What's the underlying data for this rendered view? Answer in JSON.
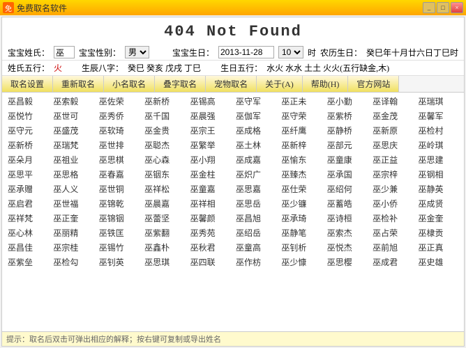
{
  "titleBar": {
    "icon": "免",
    "title": "免费取名软件",
    "controls": [
      "_",
      "□",
      "×"
    ]
  },
  "pageTitle": "404  Not  Found",
  "form": {
    "label_surname": "宝宝姓氏：",
    "surname_value": "巫",
    "label_gender": "宝宝性别：",
    "gender_options": [
      "男",
      "女"
    ],
    "gender_selected": "男",
    "label_birthday": "宝宝生日：",
    "birthday_value": "2013-11-28",
    "hour_value": "10",
    "hour_label": "时",
    "lunar_label": "农历生日：",
    "lunar_value": "癸巳年十月廿六日丁巳时",
    "label_wuxing": "姓氏五行：",
    "wuxing_value": "火",
    "label_bazi": "生辰八字：",
    "bazi_value": "癸巳 癸亥 戊戌 丁巳",
    "label_birthday_wuxing": "生日五行：",
    "birthday_wuxing": "水火 水水 土土 火火(五行缺金,木)"
  },
  "toolbar": {
    "buttons": [
      "取名设置",
      "重新取名",
      "小名取名",
      "叠字取名",
      "宠物取名",
      "关于(A)",
      "帮助(H)",
      "官方网站"
    ]
  },
  "names": [
    [
      "巫昌毅",
      "巫索毅",
      "巫佐荣",
      "巫新桥",
      "巫锡高",
      "巫守军",
      "巫正未",
      "巫小勤",
      "巫译翰",
      "巫瑞琪"
    ],
    [
      "巫悦竹",
      "巫世可",
      "巫秀侨",
      "巫千国",
      "巫晨强",
      "巫伽军",
      "巫守荣",
      "巫紫桥",
      "巫金茂",
      "巫馨军"
    ],
    [
      "巫守元",
      "巫盛茂",
      "巫软琦",
      "巫金贵",
      "巫宗王",
      "巫成格",
      "巫纤鹰",
      "巫静桥",
      "巫新原",
      "巫检村"
    ],
    [
      "巫新桥",
      "巫瑞梵",
      "巫世排",
      "巫聪杰",
      "巫繁举",
      "巫土林",
      "巫新梓",
      "巫部元",
      "巫思庆",
      "巫岭琪"
    ],
    [
      "巫朵月",
      "巫祖业",
      "巫思棋",
      "巫心森",
      "巫小翔",
      "巫成嘉",
      "巫愉东",
      "巫童康",
      "巫正益",
      "巫思建"
    ],
    [
      "巫思平",
      "巫思格",
      "巫春嘉",
      "巫铟东",
      "巫金柱",
      "巫炽广",
      "巫臻杰",
      "巫承国",
      "巫宗梓",
      "巫钢相"
    ],
    [
      "巫承赠",
      "巫人义",
      "巫世铜",
      "巫祥松",
      "巫童嘉",
      "巫思嘉",
      "巫仕荣",
      "巫绍何",
      "巫少兼",
      "巫静英"
    ],
    [
      "巫启君",
      "巫世福",
      "巫锦乾",
      "巫晨嘉",
      "巫祥相",
      "巫思岳",
      "巫少镰",
      "巫蓄皓",
      "巫小侨",
      "巫成贤"
    ],
    [
      "巫祥梵",
      "巫正奎",
      "巫锦铟",
      "巫蕾坚",
      "巫馨颜",
      "巫昌旭",
      "巫承琦",
      "巫诗桓",
      "巫检补",
      "巫金奎"
    ],
    [
      "巫心林",
      "巫丽精",
      "巫铁匡",
      "巫紫翻",
      "巫秀苑",
      "巫绍岳",
      "巫静笔",
      "巫索杰",
      "巫占荣",
      "巫棣贡"
    ],
    [
      "巫昌佳",
      "巫宗桂",
      "巫锡竹",
      "巫鑫朴",
      "巫秋君",
      "巫童高",
      "巫钊析",
      "巫悦杰",
      "巫前旭",
      "巫正真"
    ],
    [
      "巫紫垒",
      "巫检勾",
      "巫钊英",
      "巫思琪",
      "巫四联",
      "巫作枋",
      "巫少慷",
      "巫思樱",
      "巫成君",
      "巫史雄"
    ]
  ],
  "statusBar": {
    "text": "提示：取名后双击可弹出相应的解释；按右键可复制或导出姓名"
  }
}
